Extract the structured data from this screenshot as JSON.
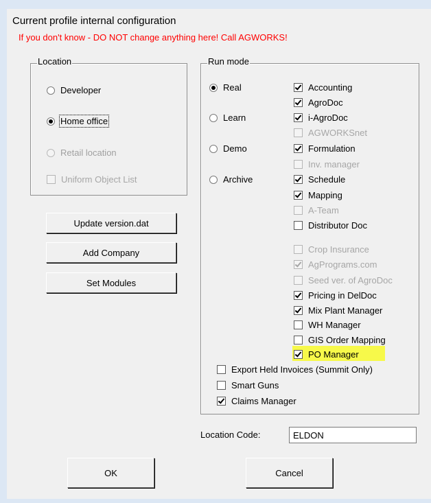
{
  "dialog": {
    "title": "Current profile internal configuration",
    "warning": "If you don't know - DO NOT change anything here! Call AGWORKS!"
  },
  "location": {
    "legend": "Location",
    "options": [
      {
        "label": "Developer",
        "selected": false,
        "enabled": true
      },
      {
        "label": "Home office",
        "selected": true,
        "enabled": true
      },
      {
        "label": "Retail location",
        "selected": false,
        "enabled": false
      }
    ],
    "uniform_object_list": {
      "label": "Uniform Object List",
      "checked": false,
      "enabled": false
    }
  },
  "buttons": {
    "update_version": "Update version.dat",
    "add_company": "Add Company",
    "set_modules": "Set Modules",
    "ok": "OK",
    "cancel": "Cancel"
  },
  "run_mode": {
    "legend": "Run mode",
    "options": [
      {
        "label": "Real",
        "selected": true
      },
      {
        "label": "Learn",
        "selected": false
      },
      {
        "label": "Demo",
        "selected": false
      },
      {
        "label": "Archive",
        "selected": false
      }
    ],
    "modules": [
      {
        "label": "Accounting",
        "checked": true,
        "enabled": true
      },
      {
        "label": "AgroDoc",
        "checked": true,
        "enabled": true
      },
      {
        "label": "i-AgroDoc",
        "checked": true,
        "enabled": true
      },
      {
        "label": "AGWORKSnet",
        "checked": false,
        "enabled": false
      },
      {
        "label": "Formulation",
        "checked": true,
        "enabled": true
      },
      {
        "label": "Inv. manager",
        "checked": false,
        "enabled": false
      },
      {
        "label": "Schedule",
        "checked": true,
        "enabled": true
      },
      {
        "label": "Mapping",
        "checked": true,
        "enabled": true
      },
      {
        "label": "A-Team",
        "checked": false,
        "enabled": false
      },
      {
        "label": "Distributor Doc",
        "checked": false,
        "enabled": true
      }
    ],
    "extras": [
      {
        "label": "Crop Insurance",
        "checked": false,
        "enabled": false
      },
      {
        "label": "AgPrograms.com",
        "checked": true,
        "enabled": false
      },
      {
        "label": "Seed ver. of AgroDoc",
        "checked": false,
        "enabled": false
      },
      {
        "label": "Pricing in DelDoc",
        "checked": true,
        "enabled": true
      },
      {
        "label": "Mix Plant Manager",
        "checked": true,
        "enabled": true
      },
      {
        "label": "WH Manager",
        "checked": false,
        "enabled": true
      },
      {
        "label": "GIS Order Mapping",
        "checked": false,
        "enabled": true
      },
      {
        "label": "PO Manager",
        "checked": true,
        "enabled": true,
        "highlight": "#f7f94a"
      }
    ],
    "bottom": [
      {
        "label": "Export Held Invoices (Summit Only)",
        "checked": false,
        "enabled": true
      },
      {
        "label": "Smart Guns",
        "checked": false,
        "enabled": true
      },
      {
        "label": "Claims Manager",
        "checked": true,
        "enabled": true
      }
    ]
  },
  "location_code": {
    "label": "Location Code:",
    "value": "ELDON"
  },
  "colors": {
    "warning": "#ff0000",
    "highlight": "#f7f94a",
    "frame": "#dce7f4"
  }
}
